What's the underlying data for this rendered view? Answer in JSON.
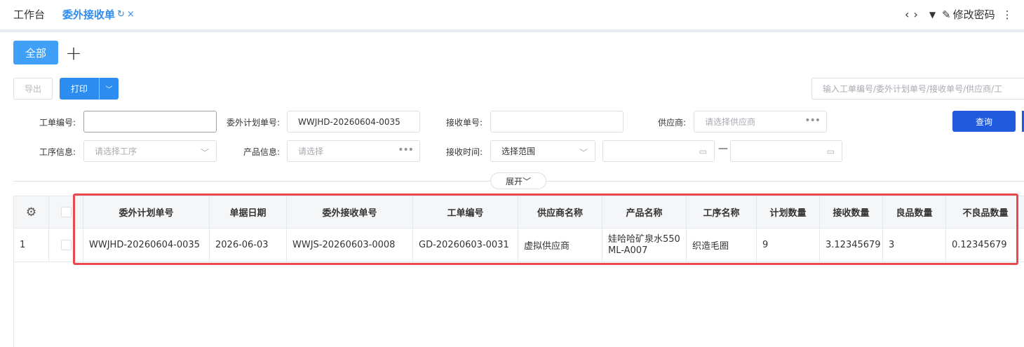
{
  "header": {
    "tab_workbench": "工作台",
    "tab_active": "委外接收单",
    "refresh_icon": "↻",
    "close_icon": "×",
    "nav_prev": "‹",
    "nav_next": "›",
    "dropdown_icon": "▼",
    "edit_icon": "✎",
    "change_password": "修改密码",
    "more": "⋮"
  },
  "views": {
    "all_label": "全部",
    "add_icon": "+"
  },
  "toolbar": {
    "export_label": "导出",
    "print_label": "打印",
    "print_arrow": "﹀",
    "search_placeholder": "输入工单编号/委外计划单号/接收单号/供应商/工"
  },
  "filters": {
    "work_order_label": "工单编号:",
    "work_order_value": "",
    "plan_no_label": "委外计划单号:",
    "plan_no_value": "WWJHD-20260604-0035",
    "receive_no_label": "接收单号:",
    "receive_no_value": "",
    "supplier_label": "供应商:",
    "supplier_placeholder": "请选择供应商",
    "process_label": "工序信息:",
    "process_placeholder": "请选择工序",
    "product_label": "产品信息:",
    "product_placeholder": "请选择",
    "receive_time_label": "接收时间:",
    "receive_time_value": "选择范围",
    "range_separator": "—",
    "query_label": "查询",
    "expand_label": "展开﹀"
  },
  "table": {
    "columns": [
      "委外计划单号",
      "单据日期",
      "委外接收单号",
      "工单编号",
      "供应商名称",
      "产品名称",
      "工序名称",
      "计划数量",
      "接收数量",
      "良品数量",
      "不良品数量"
    ],
    "rows": [
      {
        "index": "1",
        "cells": [
          "WWJHD-20260604-0035",
          "2026-06-03",
          "WWJS-20260603-0008",
          "GD-20260603-0031",
          "虚拟供应商",
          "娃哈哈矿泉水550ML-A007",
          "织造毛圈",
          "9",
          "3.12345679",
          "3",
          "0.12345679"
        ]
      }
    ]
  },
  "colors": {
    "primary": "#2d8cf0",
    "all_button": "#40a0f8",
    "query_button": "#1f5bdc",
    "highlight": "#e8494c"
  }
}
